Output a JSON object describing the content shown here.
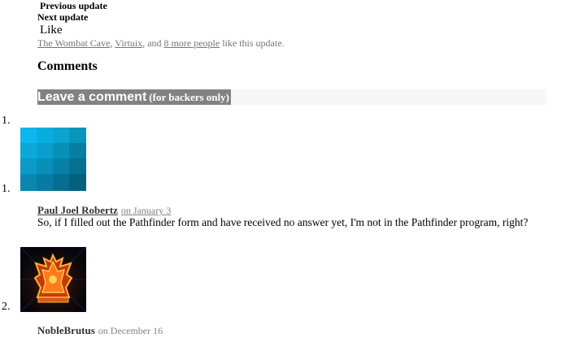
{
  "nav": {
    "previous_label": "Previous update",
    "next_label": "Next update"
  },
  "like": {
    "button_label": "Like",
    "likers": [
      "The Wombat Cave",
      "Virtuix",
      "8 more people"
    ],
    "sep1": ", ",
    "sep2": ", and ",
    "suffix": " like this update."
  },
  "comments": {
    "heading": "Comments",
    "leave_label": "Leave a comment",
    "leave_sub": "(for backers only)",
    "outer_number": "1.",
    "items": [
      {
        "number": "1.",
        "author": "Paul Joel Robertz",
        "date": "on January 3",
        "body": "So, if I filled out the Pathfinder form and have received no answer yet, I'm not in the Pathfinder program, right?"
      },
      {
        "number": "2.",
        "author": "NobleBrutus",
        "date": "on December 16"
      }
    ]
  }
}
